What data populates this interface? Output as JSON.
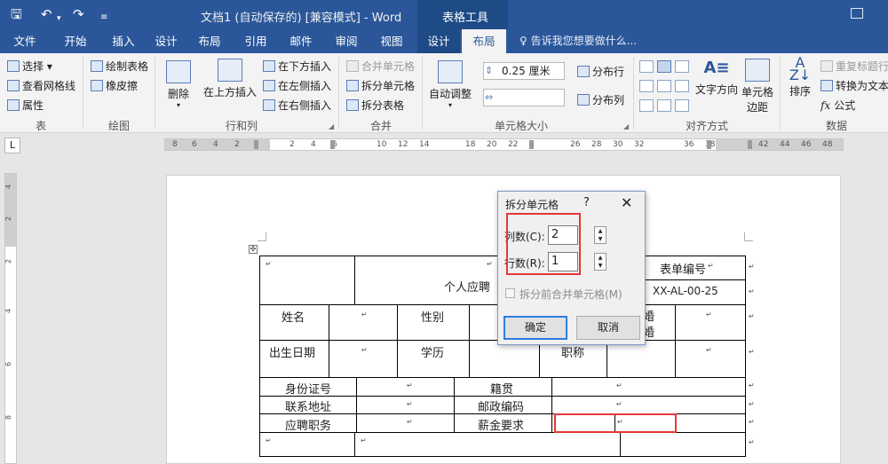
{
  "titlebar": {
    "save_icon": "save-icon",
    "undo_icon": "undo-icon",
    "redo_icon": "redo-icon",
    "customize_icon": "customize-toolbar-icon",
    "title": "文档1 (自动保存的) [兼容模式] - Word",
    "context_header": "表格工具"
  },
  "tabs": [
    "文件",
    "开始",
    "插入",
    "设计",
    "布局",
    "引用",
    "邮件",
    "审阅",
    "视图",
    "设计",
    "布局"
  ],
  "tell_me": "♀ 告诉我您想要做什么...",
  "ribbon": {
    "table_group": {
      "label": "表",
      "select": "选择",
      "gridlines": "查看网格线",
      "properties": "属性"
    },
    "draw_group": {
      "label": "绘图",
      "draw_table": "绘制表格",
      "eraser": "橡皮擦"
    },
    "rows_cols_group": {
      "label": "行和列",
      "delete": "删除",
      "insert_above": "在上方插入",
      "insert_below": "在下方插入",
      "insert_left": "在左侧插入",
      "insert_right": "在右侧插入"
    },
    "merge_group": {
      "label": "合并",
      "merge_cells": "合并单元格",
      "split_cells": "拆分单元格",
      "split_table": "拆分表格"
    },
    "cell_size_group": {
      "label": "单元格大小",
      "autofit": "自动调整",
      "height_value": "0.25 厘米",
      "distribute_rows": "分布行",
      "distribute_cols": "分布列"
    },
    "alignment_group": {
      "label": "对齐方式",
      "text_direction": "文字方向",
      "cell_margins_l1": "单元格",
      "cell_margins_l2": "边距"
    },
    "data_group": {
      "label": "数据",
      "sort": "排序",
      "repeat_header": "重复标题行",
      "convert_to_text": "转换为文本",
      "formula": "公式"
    }
  },
  "ruler": {
    "corner": "L",
    "numbers": [
      "8",
      "6",
      "4",
      "2",
      "2",
      "4",
      "6",
      "10",
      "12",
      "14",
      "18",
      "20",
      "22",
      "26",
      "28",
      "30",
      "32",
      "36",
      "38",
      "42",
      "44",
      "46",
      "48"
    ]
  },
  "vruler_numbers": [
    "4",
    "2",
    "2",
    "4",
    "6",
    "8"
  ],
  "table": {
    "r1c3": "表单编号",
    "title": "个人应聘",
    "r2c3": "XX-AL-00-25",
    "name": "姓名",
    "gender": "性别",
    "marriage_1": "婚",
    "marriage_2": "婚",
    "birth": "出生日期",
    "education": "学历",
    "title_job": "职称",
    "id_no": "身份证号",
    "native_place": "籍贯",
    "address": "联系地址",
    "postcode": "邮政编码",
    "position": "应聘职务",
    "salary": "薪金要求",
    "para_mark": "↵"
  },
  "dialog": {
    "title": "拆分单元格",
    "help": "?",
    "close": "✕",
    "cols_label": "列数(C):",
    "cols_value": "2",
    "rows_label": "行数(R):",
    "rows_value": "1",
    "merge_before_label": "拆分前合并单元格(M)",
    "ok": "确定",
    "cancel": "取消"
  },
  "colors": {
    "brand": "#2b579a",
    "highlight": "#e53935"
  }
}
